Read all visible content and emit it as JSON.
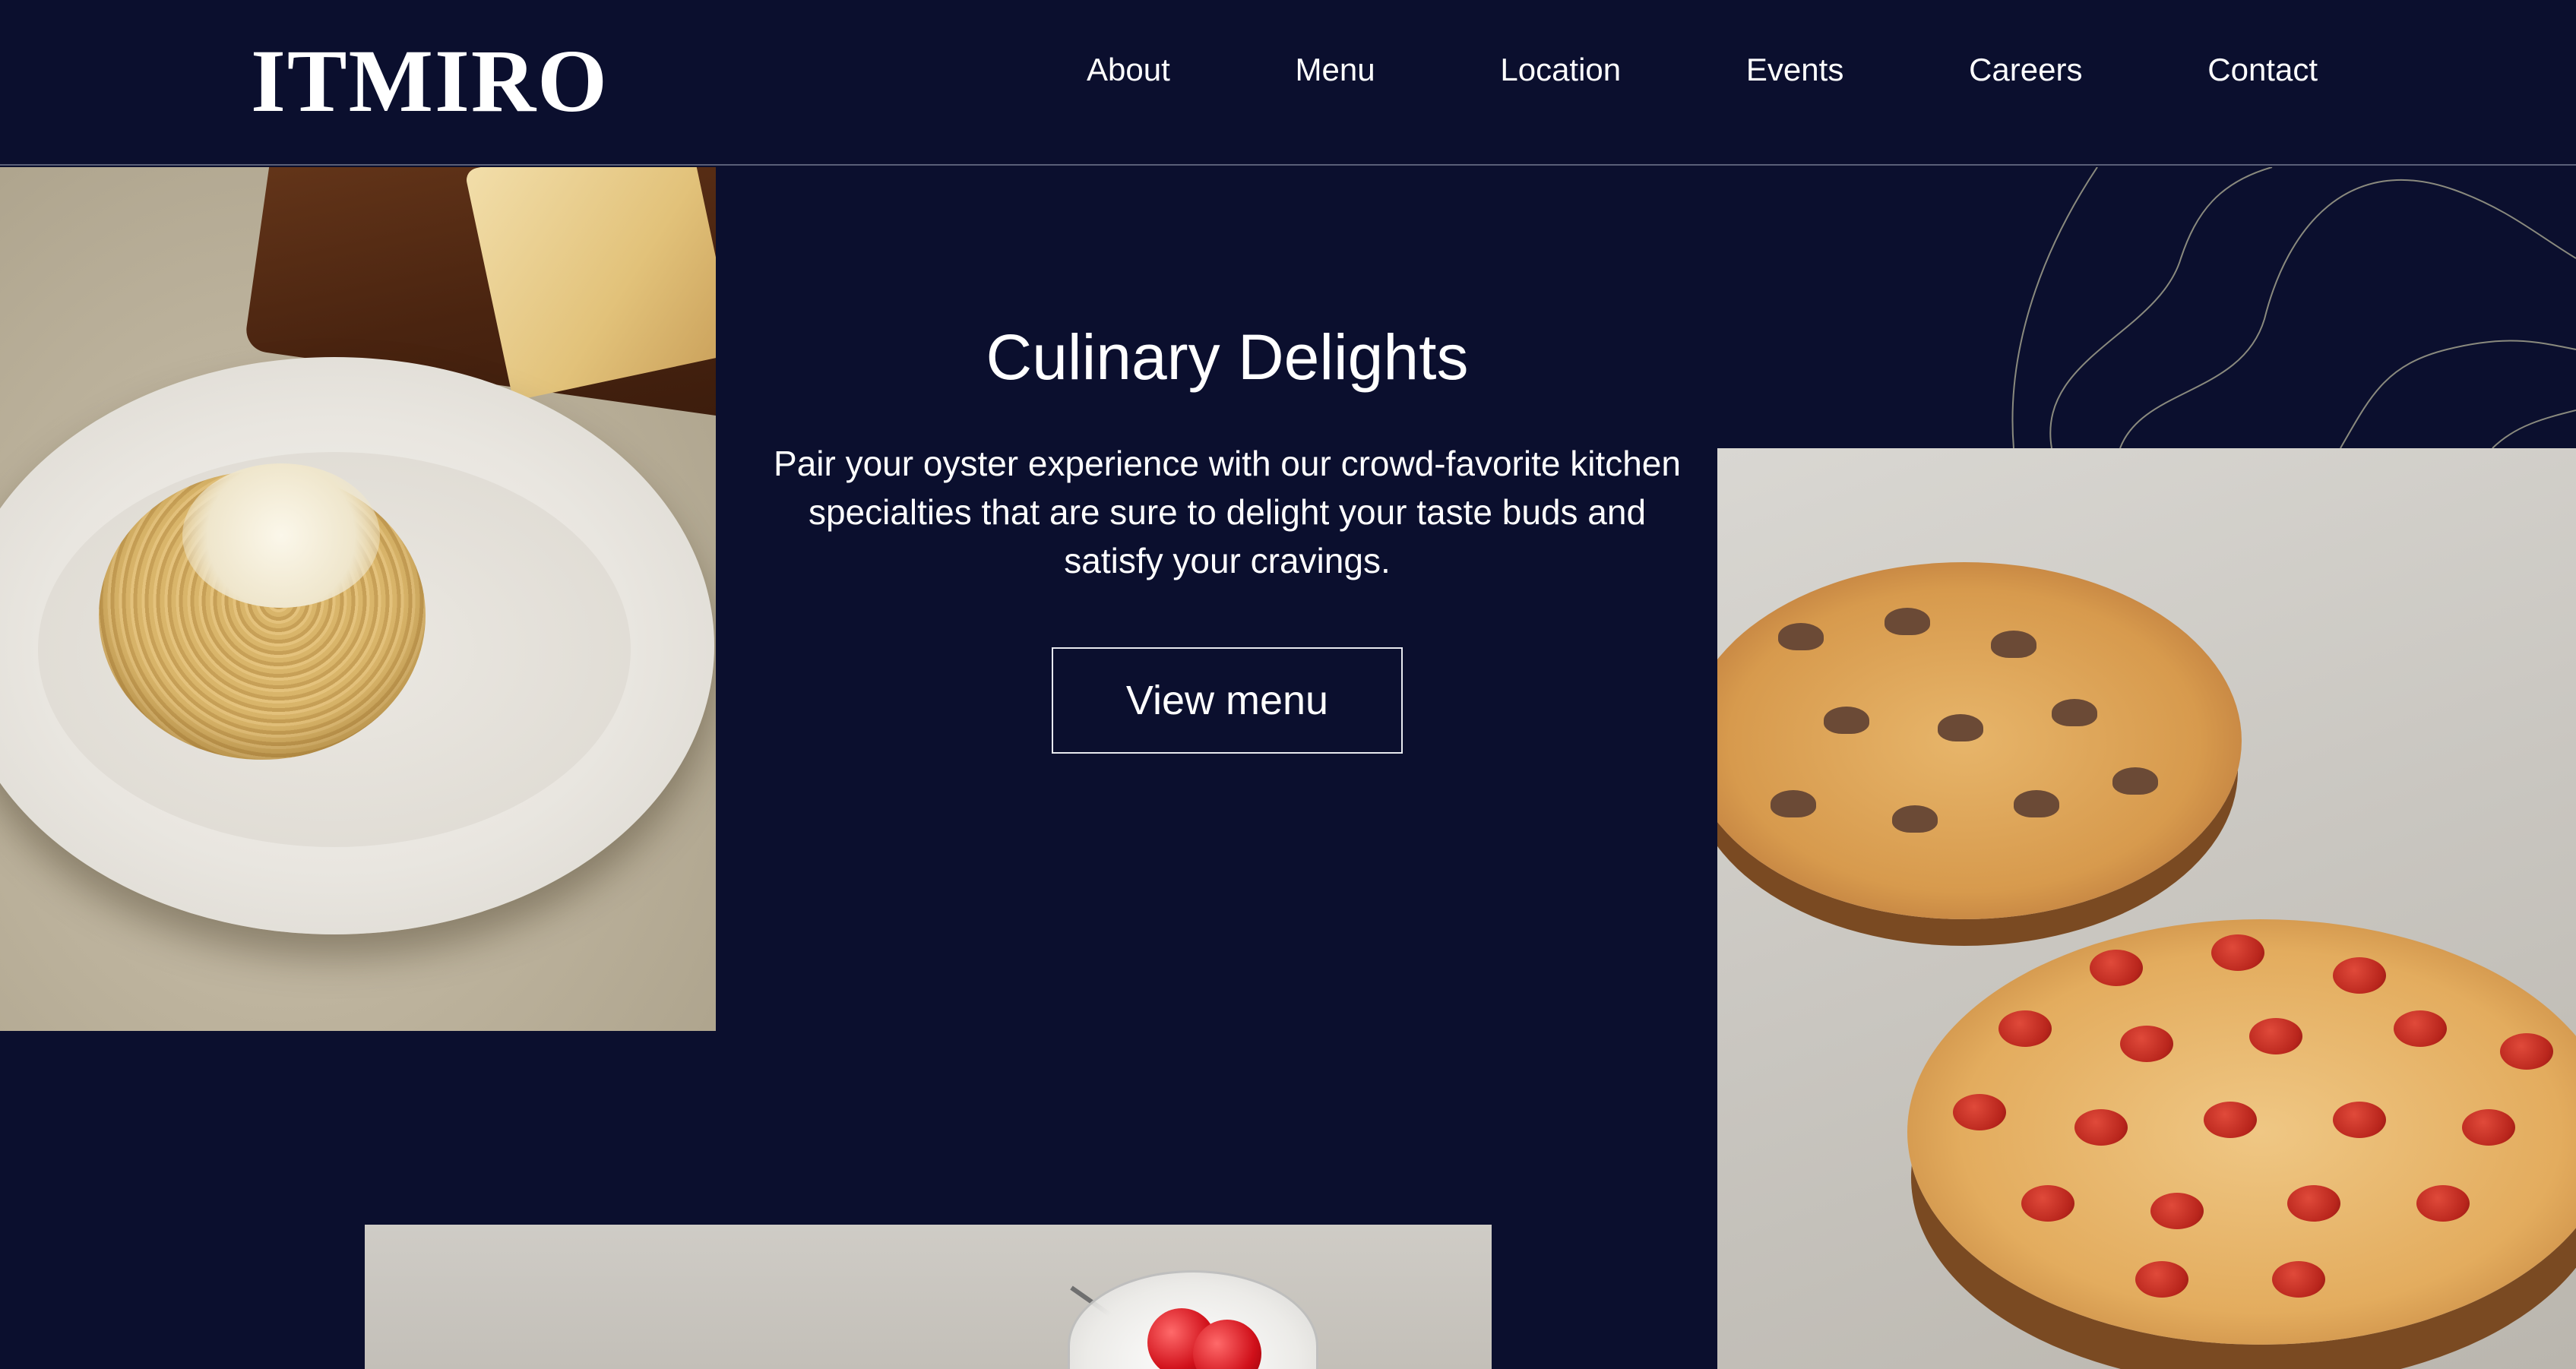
{
  "header": {
    "logo": "ITMIRO",
    "nav": [
      "About",
      "Menu",
      "Location",
      "Events",
      "Careers",
      "Contact"
    ]
  },
  "hero": {
    "title": "Culinary Delights",
    "description": "Pair your oyster experience with our crowd-favorite kitchen specialties that are sure to delight your taste buds and satisfy your cravings.",
    "button_label": "View menu"
  },
  "images": {
    "left": "spaghetti-dish-photo",
    "right": "pizzas-photo",
    "bottom": "dessert-photo",
    "decoration": "topographic-lines"
  },
  "colors": {
    "background": "#0b0f2e",
    "text": "#ffffff",
    "button_border": "#e8e9ef",
    "topo_lines": "#8a8a7e"
  }
}
